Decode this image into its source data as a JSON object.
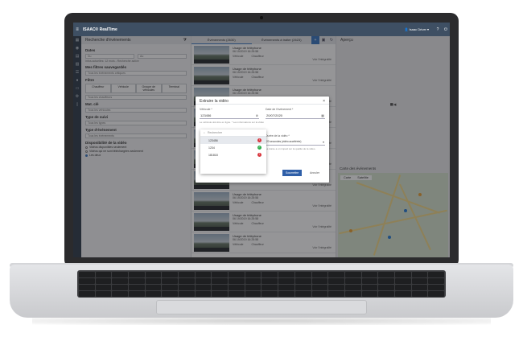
{
  "app": {
    "title": "ISAAC® RealTime",
    "user": "Isaac Driver"
  },
  "left_panel": {
    "title": "Recherche d'événements",
    "dates_title": "Dates",
    "date_from": "Du",
    "date_to": "Au",
    "date_note": "Infos actuelles: 12 mois - Recherche active",
    "filters_title": "Mes filtres sauvegardés",
    "filters_value": "Tous les événements critiques",
    "filter_label": "Filtre",
    "tabs": [
      "Chauffeur",
      "Véhicule",
      "Groupe de véhicules",
      "Terminal"
    ],
    "driver_placeholder": "Tous les chauffeurs",
    "maj_title": "Mat. clé",
    "maj_value": "Tous les véhicules",
    "type_title": "Type de suivi",
    "type_value": "Tous les types",
    "event_title": "Type d'événement",
    "event_value": "Tous les événements",
    "video_title": "Disponibilité de la vidéo",
    "radios": [
      "Vidéos disponibles seulement",
      "Vidéos qui ne sont téléchargées seulement",
      "Les deux"
    ]
  },
  "middle_panel": {
    "tab_events": "Événements (2630)",
    "tab_studio": "Événements à traiter (2623)",
    "cards": [
      {
        "title": "Usage de téléphone",
        "date": "06 19/2019 16:25:58",
        "vehicle": "Véhicule",
        "driver": "Chauffeur",
        "action": "Voir l'intégralité"
      },
      {
        "title": "Usage de téléphone",
        "date": "06 19/2019 16:25:58",
        "vehicle": "Véhicule",
        "driver": "Chauffeur",
        "action": "Voir l'intégralité"
      },
      {
        "title": "Usage de téléphone",
        "date": "06 19/2019 16:25:58",
        "vehicle": "Véhicule",
        "driver": "Chauffeur",
        "action": "Voir l'intégralité"
      },
      {
        "title": "Usage de téléphone",
        "date": "06 19/2019 16:25:58",
        "vehicle": "Véhicule",
        "driver": "Chauffeur",
        "action": "Voir l'intégralité"
      },
      {
        "title": "Usage de téléphone",
        "date": "06 19/2019 16:25:58",
        "vehicle": "Véhicule",
        "driver": "Chauffeur",
        "action": "Voir l'intégralité"
      },
      {
        "title": "Usage de téléphone",
        "date": "06 19/2019 16:25:58",
        "vehicle": "Véhicule",
        "driver": "Chauffeur",
        "action": "Voir l'intégralité"
      },
      {
        "title": "Usage de téléphone",
        "date": "06 19/2019 16:25:58",
        "vehicle": "Véhicule",
        "driver": "Chauffeur",
        "action": "Voir l'intégralité"
      },
      {
        "title": "Usage de téléphone",
        "date": "06 19/2019 16:25:58",
        "vehicle": "Véhicule",
        "driver": "Chauffeur",
        "action": "Voir l'intégralité"
      },
      {
        "title": "Usage de téléphone",
        "date": "06 19/2019 16:25:58",
        "vehicle": "Véhicule",
        "driver": "Chauffeur",
        "action": "Voir l'intégralité"
      },
      {
        "title": "Usage de téléphone",
        "date": "06 19/2019 16:25:58",
        "vehicle": "Véhicule",
        "driver": "Chauffeur",
        "action": "Voir l'intégralité"
      }
    ]
  },
  "right_panel": {
    "preview_title": "Aperçu",
    "map_title": "Carte des événements",
    "map_btn_map": "Carte",
    "map_btn_sat": "Satellite"
  },
  "modal": {
    "title": "Extraire la vidéo",
    "vehicle_label": "Véhicule *",
    "vehicle_value": "123456",
    "vehicle_hint": "Le véhicule doit être en ligne. * Les informations sur la vidéo",
    "date_label": "Date de l'événement *",
    "date_value": "20/07/2020",
    "duration_label": "Durée de la vidéo *",
    "duration_value": "20 secondes (vidéo accélérée)",
    "duration_hint": "La durée a un impact sur la qualité de la vidéo.",
    "submit": "Soumettre",
    "cancel": "Annuler"
  },
  "dropdown": {
    "search_placeholder": "Rechercher",
    "options": [
      {
        "label": "123456",
        "status": "red"
      },
      {
        "label": "1234",
        "status": "green"
      },
      {
        "label": "181818",
        "status": "red"
      }
    ]
  },
  "colors": {
    "appbar": "#3e4f63",
    "primary": "#2f5fa8",
    "ok": "#2eae4c",
    "error": "#d9363e"
  }
}
